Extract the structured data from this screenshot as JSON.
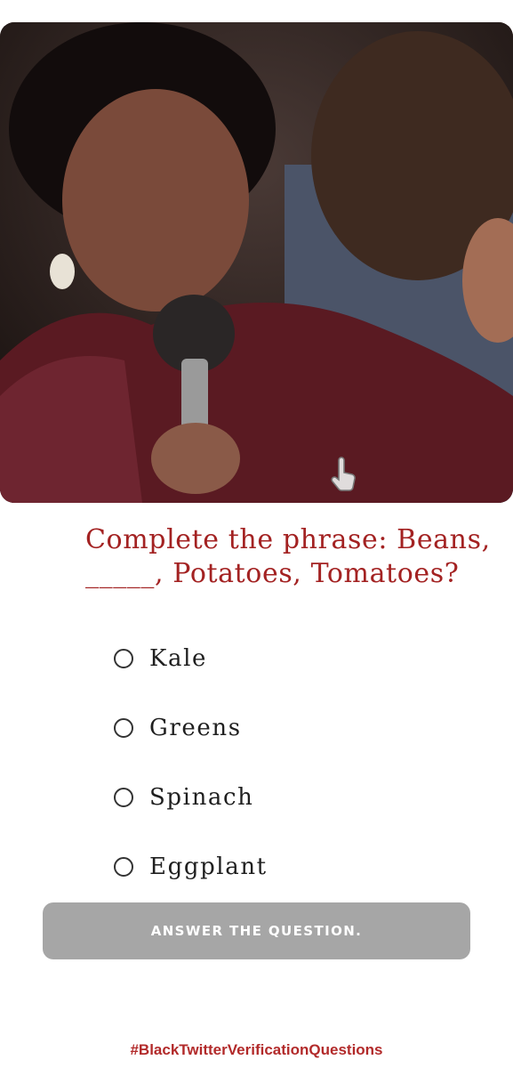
{
  "media": {
    "tap_icon": "pointing-hand-icon"
  },
  "quiz": {
    "question": "Complete the phrase: Beans, _____, Potatoes, Tomatoes?",
    "options": [
      "Kale",
      "Greens",
      "Spinach",
      "Eggplant"
    ],
    "submit_label": "ANSWER THE QUESTION."
  },
  "footer": {
    "hashtag": "#BlackTwitterVerificationQuestions"
  },
  "colors": {
    "question": "#a32222",
    "button": "#a6a6a6",
    "hashtag": "#b22a2a"
  }
}
